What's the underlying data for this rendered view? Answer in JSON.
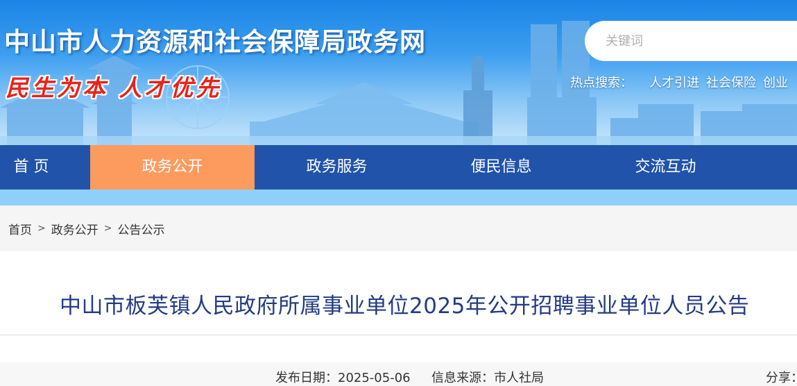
{
  "header": {
    "site_title": "中山市人力资源和社会保障局政务网",
    "slogan": "民生为本 人才优先",
    "search": {
      "placeholder": "关键词",
      "value": ""
    },
    "hot_search": {
      "label": "热点搜索：",
      "links": [
        "人才引进",
        "社会保险",
        "创业"
      ]
    }
  },
  "nav": {
    "items": [
      {
        "label": "首 页"
      },
      {
        "label": "政务公开"
      },
      {
        "label": "政务服务"
      },
      {
        "label": "便民信息"
      },
      {
        "label": "交流互动"
      }
    ],
    "active_index": 1
  },
  "breadcrumb": {
    "items": [
      "首页",
      "政务公开",
      "公告公示"
    ],
    "separator": ">"
  },
  "article": {
    "title": "中山市板芙镇人民政府所属事业单位2025年公开招聘事业单位人员公告",
    "date_label": "发布日期：",
    "date": "2025-05-06",
    "source_label": "信息来源：",
    "source": "市人社局",
    "share_label": "分享："
  },
  "colors": {
    "nav_bg": "#2153aa",
    "nav_active": "#fd9a5e",
    "strip": "#8fd0fa",
    "title_text": "#243b84",
    "slogan": "#e8231a"
  }
}
